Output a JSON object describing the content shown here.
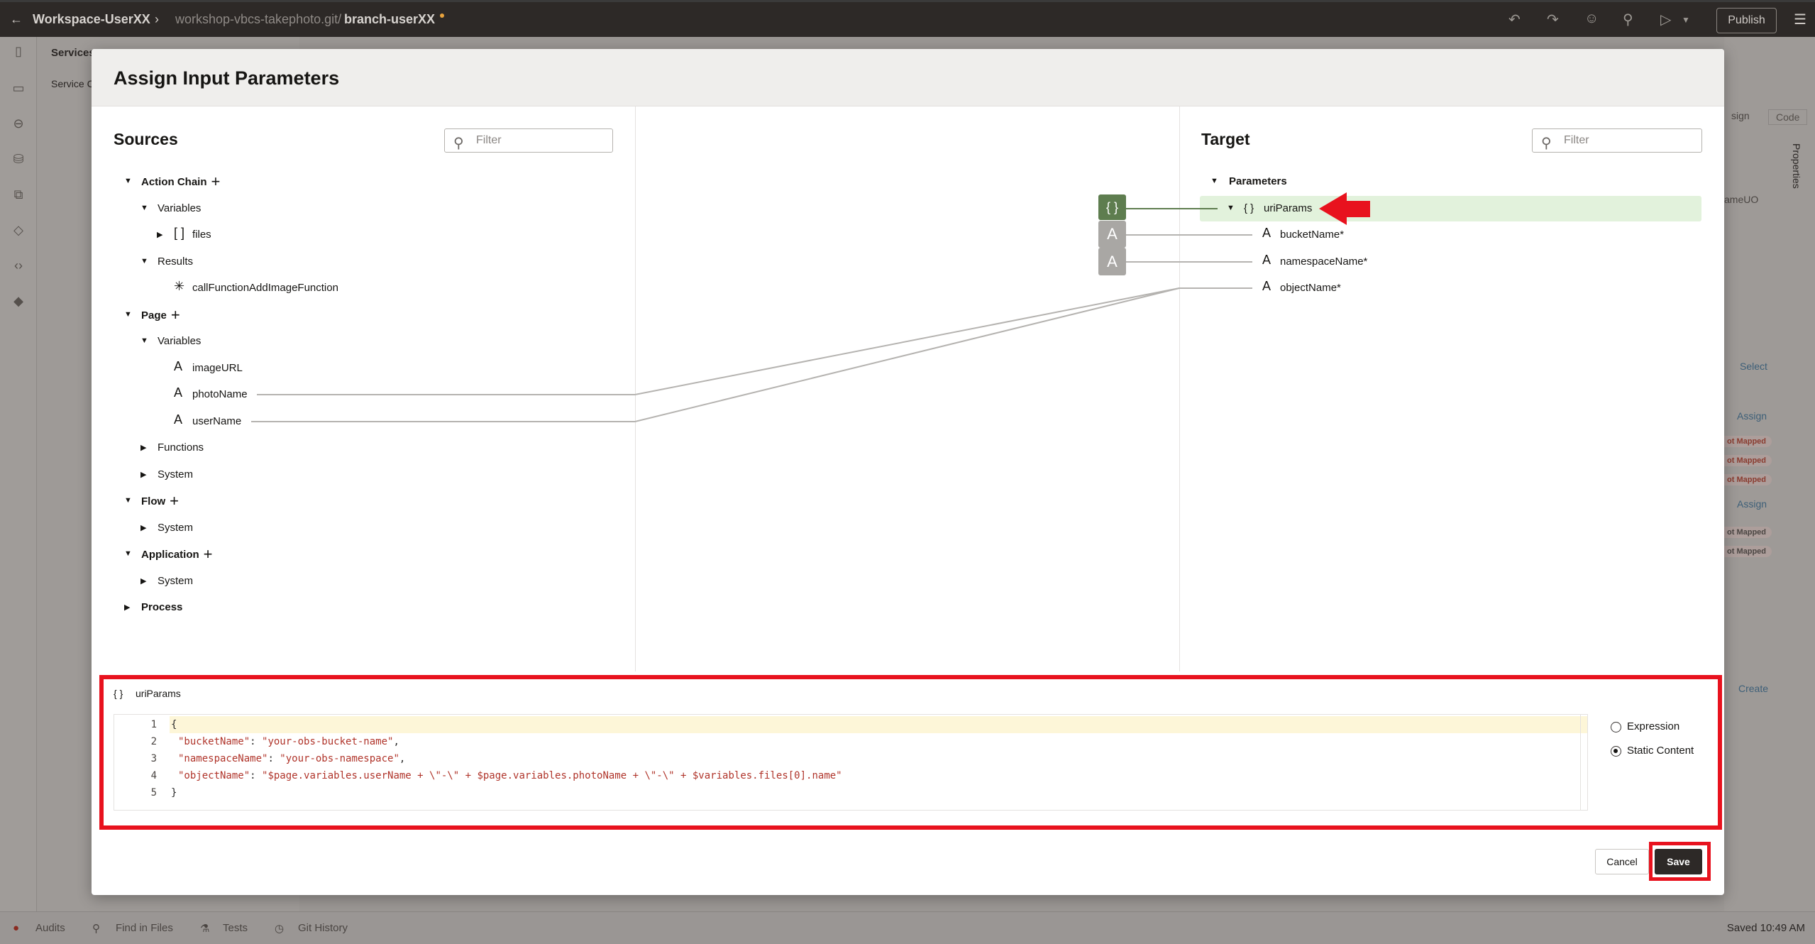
{
  "topbar": {
    "workspace": "Workspace-UserXX",
    "repo": "workshop-vbcs-takephoto.git/",
    "branch": "branch-userXX",
    "publish": "Publish",
    "icons": [
      "undo-icon",
      "redo-icon",
      "feedback-icon",
      "search-icon",
      "run-icon",
      "menu-icon"
    ]
  },
  "background": {
    "panel_title": "Services",
    "panel_tab": "Service C",
    "right_tabs": [
      "sign",
      "Code"
    ],
    "right_field": "ameUO",
    "select": "Select",
    "assign": "Assign",
    "not_mapped": "ot Mapped",
    "create": "Create",
    "properties": "Properties"
  },
  "modal": {
    "title": "Assign Input Parameters",
    "sources": {
      "title": "Sources",
      "filter_placeholder": "Filter",
      "tree": [
        {
          "label": "Action Chain",
          "level": 0,
          "caret": "down",
          "bold": true,
          "plus": true
        },
        {
          "label": "Variables",
          "level": 1,
          "caret": "down"
        },
        {
          "label": "files",
          "level": 2,
          "caret": "right",
          "icon": "[ ]"
        },
        {
          "label": "Results",
          "level": 1,
          "caret": "down"
        },
        {
          "label": "callFunctionAddImageFunction",
          "level": 2,
          "icon": "✳"
        },
        {
          "label": "Page",
          "level": 0,
          "caret": "down",
          "bold": true,
          "plus": true
        },
        {
          "label": "Variables",
          "level": 1,
          "caret": "down"
        },
        {
          "label": "imageURL",
          "level": 2,
          "icon": "A"
        },
        {
          "label": "photoName",
          "level": 2,
          "icon": "A"
        },
        {
          "label": "userName",
          "level": 2,
          "icon": "A"
        },
        {
          "label": "Functions",
          "level": 1,
          "caret": "right"
        },
        {
          "label": "System",
          "level": 1,
          "caret": "right"
        },
        {
          "label": "Flow",
          "level": 0,
          "caret": "down",
          "bold": true,
          "plus": true
        },
        {
          "label": "System",
          "level": 1,
          "caret": "right"
        },
        {
          "label": "Application",
          "level": 0,
          "caret": "down",
          "bold": true,
          "plus": true
        },
        {
          "label": "System",
          "level": 1,
          "caret": "right"
        },
        {
          "label": "Process",
          "level": 0,
          "caret": "right",
          "bold": true
        }
      ]
    },
    "target": {
      "title": "Target",
      "filter_placeholder": "Filter",
      "group": "Parameters",
      "selected": {
        "icon": "{ }",
        "label": "uriParams"
      },
      "children": [
        "bucketName*",
        "namespaceName*",
        "objectName*"
      ]
    },
    "mapping_boxes": [
      "{ }",
      "A",
      "A"
    ],
    "detail": {
      "icon": "{ }",
      "label": "uriParams",
      "code_lines": [
        {
          "n": "1",
          "text": "{"
        },
        {
          "n": "2",
          "key": "\"bucketName\"",
          "value": "\"your-obs-bucket-name\"",
          "end": ","
        },
        {
          "n": "3",
          "key": "\"namespaceName\"",
          "value": "\"your-obs-namespace\"",
          "end": ","
        },
        {
          "n": "4",
          "key": "\"objectName\"",
          "value": "\"$page.variables.userName + \\\"-\\\" + $page.variables.photoName + \\\"-\\\" + $variables.files[0].name\"",
          "end": ""
        },
        {
          "n": "5",
          "text": "}"
        }
      ],
      "options": [
        {
          "label": "Expression",
          "selected": false
        },
        {
          "label": "Static Content",
          "selected": true
        }
      ]
    },
    "cancel": "Cancel",
    "save": "Save"
  },
  "statusbar": {
    "items": [
      "Audits",
      "Find in Files",
      "Tests",
      "Git History"
    ],
    "saved": "Saved 10:49 AM"
  },
  "colors": {
    "highlight": "#e8121e",
    "mapped": "#5e7d4f",
    "selected_row": "#e2f2dc"
  }
}
